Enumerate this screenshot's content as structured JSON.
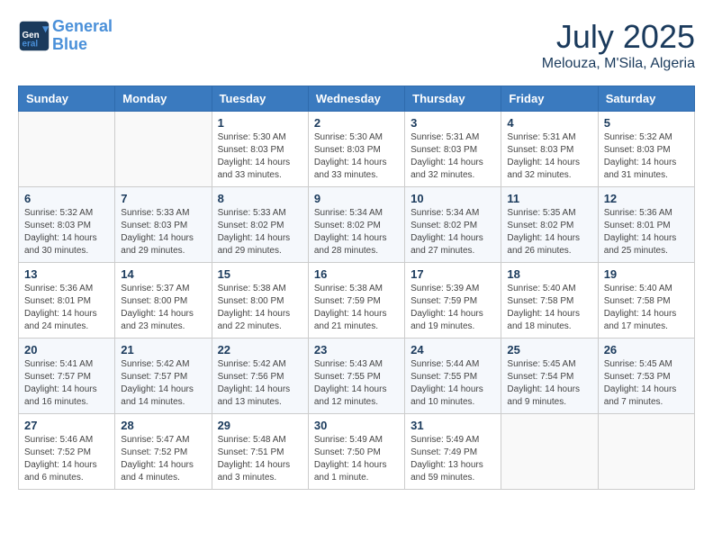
{
  "header": {
    "logo_line1": "General",
    "logo_line2": "Blue",
    "month": "July 2025",
    "location": "Melouza, M'Sila, Algeria"
  },
  "weekdays": [
    "Sunday",
    "Monday",
    "Tuesday",
    "Wednesday",
    "Thursday",
    "Friday",
    "Saturday"
  ],
  "weeks": [
    [
      {
        "day": "",
        "info": ""
      },
      {
        "day": "",
        "info": ""
      },
      {
        "day": "1",
        "info": "Sunrise: 5:30 AM\nSunset: 8:03 PM\nDaylight: 14 hours and 33 minutes."
      },
      {
        "day": "2",
        "info": "Sunrise: 5:30 AM\nSunset: 8:03 PM\nDaylight: 14 hours and 33 minutes."
      },
      {
        "day": "3",
        "info": "Sunrise: 5:31 AM\nSunset: 8:03 PM\nDaylight: 14 hours and 32 minutes."
      },
      {
        "day": "4",
        "info": "Sunrise: 5:31 AM\nSunset: 8:03 PM\nDaylight: 14 hours and 32 minutes."
      },
      {
        "day": "5",
        "info": "Sunrise: 5:32 AM\nSunset: 8:03 PM\nDaylight: 14 hours and 31 minutes."
      }
    ],
    [
      {
        "day": "6",
        "info": "Sunrise: 5:32 AM\nSunset: 8:03 PM\nDaylight: 14 hours and 30 minutes."
      },
      {
        "day": "7",
        "info": "Sunrise: 5:33 AM\nSunset: 8:03 PM\nDaylight: 14 hours and 29 minutes."
      },
      {
        "day": "8",
        "info": "Sunrise: 5:33 AM\nSunset: 8:02 PM\nDaylight: 14 hours and 29 minutes."
      },
      {
        "day": "9",
        "info": "Sunrise: 5:34 AM\nSunset: 8:02 PM\nDaylight: 14 hours and 28 minutes."
      },
      {
        "day": "10",
        "info": "Sunrise: 5:34 AM\nSunset: 8:02 PM\nDaylight: 14 hours and 27 minutes."
      },
      {
        "day": "11",
        "info": "Sunrise: 5:35 AM\nSunset: 8:02 PM\nDaylight: 14 hours and 26 minutes."
      },
      {
        "day": "12",
        "info": "Sunrise: 5:36 AM\nSunset: 8:01 PM\nDaylight: 14 hours and 25 minutes."
      }
    ],
    [
      {
        "day": "13",
        "info": "Sunrise: 5:36 AM\nSunset: 8:01 PM\nDaylight: 14 hours and 24 minutes."
      },
      {
        "day": "14",
        "info": "Sunrise: 5:37 AM\nSunset: 8:00 PM\nDaylight: 14 hours and 23 minutes."
      },
      {
        "day": "15",
        "info": "Sunrise: 5:38 AM\nSunset: 8:00 PM\nDaylight: 14 hours and 22 minutes."
      },
      {
        "day": "16",
        "info": "Sunrise: 5:38 AM\nSunset: 7:59 PM\nDaylight: 14 hours and 21 minutes."
      },
      {
        "day": "17",
        "info": "Sunrise: 5:39 AM\nSunset: 7:59 PM\nDaylight: 14 hours and 19 minutes."
      },
      {
        "day": "18",
        "info": "Sunrise: 5:40 AM\nSunset: 7:58 PM\nDaylight: 14 hours and 18 minutes."
      },
      {
        "day": "19",
        "info": "Sunrise: 5:40 AM\nSunset: 7:58 PM\nDaylight: 14 hours and 17 minutes."
      }
    ],
    [
      {
        "day": "20",
        "info": "Sunrise: 5:41 AM\nSunset: 7:57 PM\nDaylight: 14 hours and 16 minutes."
      },
      {
        "day": "21",
        "info": "Sunrise: 5:42 AM\nSunset: 7:57 PM\nDaylight: 14 hours and 14 minutes."
      },
      {
        "day": "22",
        "info": "Sunrise: 5:42 AM\nSunset: 7:56 PM\nDaylight: 14 hours and 13 minutes."
      },
      {
        "day": "23",
        "info": "Sunrise: 5:43 AM\nSunset: 7:55 PM\nDaylight: 14 hours and 12 minutes."
      },
      {
        "day": "24",
        "info": "Sunrise: 5:44 AM\nSunset: 7:55 PM\nDaylight: 14 hours and 10 minutes."
      },
      {
        "day": "25",
        "info": "Sunrise: 5:45 AM\nSunset: 7:54 PM\nDaylight: 14 hours and 9 minutes."
      },
      {
        "day": "26",
        "info": "Sunrise: 5:45 AM\nSunset: 7:53 PM\nDaylight: 14 hours and 7 minutes."
      }
    ],
    [
      {
        "day": "27",
        "info": "Sunrise: 5:46 AM\nSunset: 7:52 PM\nDaylight: 14 hours and 6 minutes."
      },
      {
        "day": "28",
        "info": "Sunrise: 5:47 AM\nSunset: 7:52 PM\nDaylight: 14 hours and 4 minutes."
      },
      {
        "day": "29",
        "info": "Sunrise: 5:48 AM\nSunset: 7:51 PM\nDaylight: 14 hours and 3 minutes."
      },
      {
        "day": "30",
        "info": "Sunrise: 5:49 AM\nSunset: 7:50 PM\nDaylight: 14 hours and 1 minute."
      },
      {
        "day": "31",
        "info": "Sunrise: 5:49 AM\nSunset: 7:49 PM\nDaylight: 13 hours and 59 minutes."
      },
      {
        "day": "",
        "info": ""
      },
      {
        "day": "",
        "info": ""
      }
    ]
  ]
}
